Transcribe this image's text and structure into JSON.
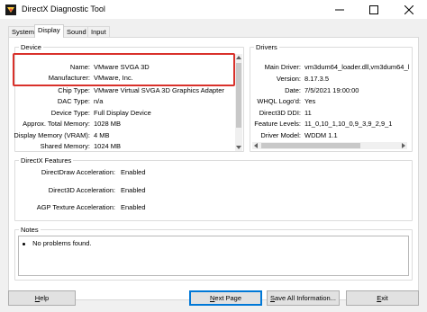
{
  "window": {
    "title": "DirectX Diagnostic Tool",
    "icons": {
      "app": "directx-icon",
      "minimize": "minimize-icon",
      "maximize": "maximize-icon",
      "close": "close-icon"
    }
  },
  "tabs": [
    {
      "label": "System",
      "active": false
    },
    {
      "label": "Display",
      "active": true
    },
    {
      "label": "Sound",
      "active": false
    },
    {
      "label": "Input",
      "active": false
    }
  ],
  "device": {
    "group_label": "Device",
    "rows": [
      {
        "label": "Name:",
        "value": "VMware SVGA 3D"
      },
      {
        "label": "Manufacturer:",
        "value": "VMware, Inc."
      },
      {
        "label": "Chip Type:",
        "value": "VMware Virtual SVGA 3D Graphics Adapter"
      },
      {
        "label": "DAC Type:",
        "value": "n/a"
      },
      {
        "label": "Device Type:",
        "value": "Full Display Device"
      },
      {
        "label": "Approx. Total Memory:",
        "value": "1028 MB"
      },
      {
        "label": "Display Memory (VRAM):",
        "value": "4 MB"
      },
      {
        "label": "Shared Memory:",
        "value": "1024 MB"
      }
    ]
  },
  "drivers": {
    "group_label": "Drivers",
    "rows": [
      {
        "label": "Main Driver:",
        "value": "vm3dum64_loader.dll,vm3dum64_loader.dll"
      },
      {
        "label": "Version:",
        "value": "8.17.3.5"
      },
      {
        "label": "Date:",
        "value": "7/5/2021 19:00:00"
      },
      {
        "label": "WHQL Logo'd:",
        "value": "Yes"
      },
      {
        "label": "Direct3D DDI:",
        "value": "11"
      },
      {
        "label": "Feature Levels:",
        "value": "11_0,10_1,10_0,9_3,9_2,9_1"
      },
      {
        "label": "Driver Model:",
        "value": "WDDM 1.1"
      }
    ]
  },
  "features": {
    "group_label": "DirectX Features",
    "rows": [
      {
        "label": "DirectDraw Acceleration:",
        "value": "Enabled"
      },
      {
        "label": "Direct3D Acceleration:",
        "value": "Enabled"
      },
      {
        "label": "AGP Texture Acceleration:",
        "value": "Enabled"
      }
    ]
  },
  "notes": {
    "group_label": "Notes",
    "items": [
      "No problems found."
    ]
  },
  "buttons": {
    "help": {
      "u": "H",
      "rest": "elp"
    },
    "next_page": {
      "u": "N",
      "rest": "ext Page"
    },
    "save_all": {
      "u": "S",
      "rest": "ave All Information..."
    },
    "exit": {
      "u": "E",
      "rest": "xit"
    }
  },
  "colors": {
    "highlight": "#d9312b",
    "accent": "#0078d7"
  }
}
